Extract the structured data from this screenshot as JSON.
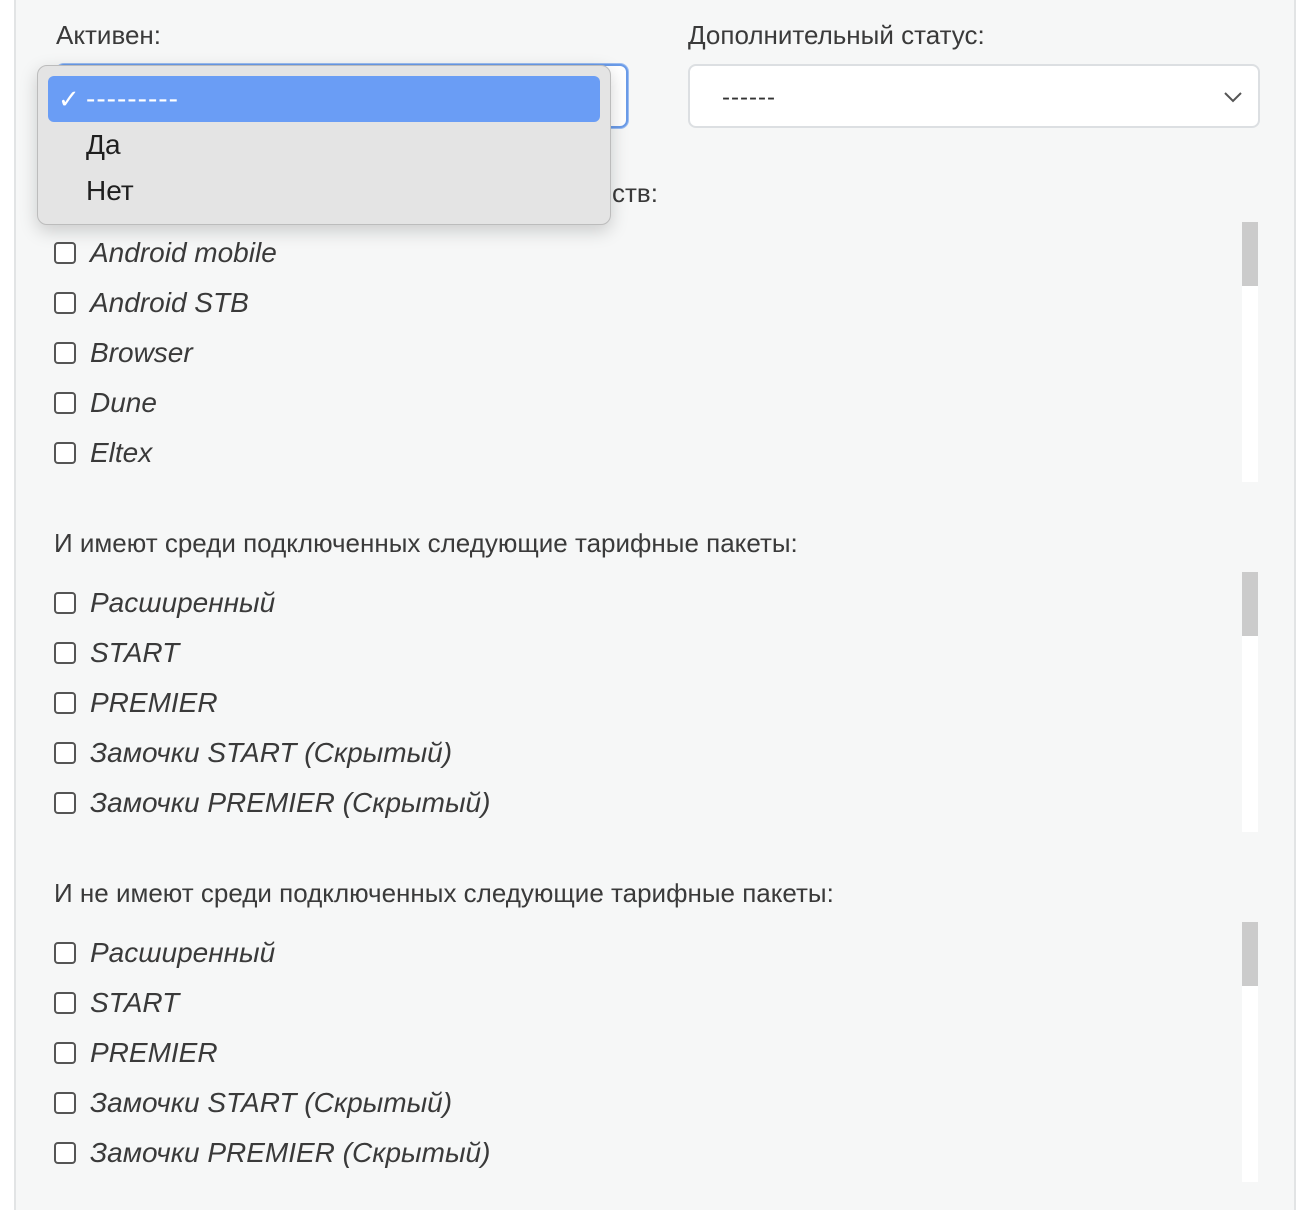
{
  "active_field": {
    "label": "Активен:",
    "selected": "---------",
    "options": [
      "---------",
      "Да",
      "Нет"
    ]
  },
  "extra_status_field": {
    "label": "Дополнительный статус:",
    "value": "------"
  },
  "devices_section": {
    "label_visible_tail": "ств:",
    "items": [
      "Android mobile",
      "Android STB",
      "Browser",
      "Dune",
      "Eltex"
    ]
  },
  "has_packages_section": {
    "label": "И имеют среди подключенных следующие тарифные пакеты:",
    "items": [
      "Расширенный",
      "START",
      "PREMIER",
      "Замочки START (Скрытый)",
      "Замочки PREMIER (Скрытый)"
    ]
  },
  "not_has_packages_section": {
    "label": "И не имеют среди подключенных следующие тарифные пакеты:",
    "items": [
      "Расширенный",
      "START",
      "PREMIER",
      "Замочки START (Скрытый)",
      "Замочки PREMIER (Скрытый)"
    ]
  },
  "icons": {
    "checkmark": "check-icon",
    "chevron": "chevron-down-icon"
  },
  "colors": {
    "selected_option_bg": "#6a9df5",
    "focus_border": "#6a9be8"
  }
}
